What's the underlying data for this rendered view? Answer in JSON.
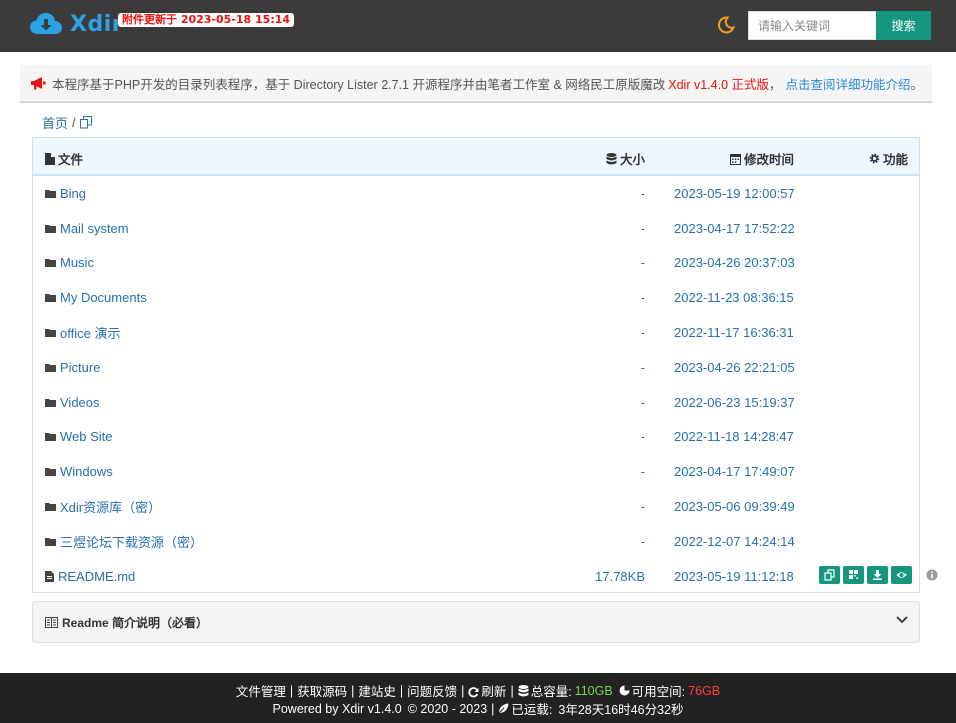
{
  "header": {
    "logo_text": "Xdir",
    "update_badge": "附件更新于 2023-05-18 15:14",
    "search_placeholder": "请输入关键词",
    "search_button": "搜索",
    "brand_color": "#2aa3e6",
    "accent_color": "#16967f"
  },
  "notice": {
    "text": "本程序基于PHP开发的目录列表程序，基于 Directory Lister 2.7.1 开源程序并由笔者工作室 & 网络民工原版魔改",
    "version": "Xdir v1.4.0 正式版",
    "separator": "，",
    "link": "点击查阅详细功能介绍",
    "end": "。"
  },
  "breadcrumb": {
    "home": "首页",
    "separator": "/"
  },
  "table": {
    "headers": {
      "file": "文件",
      "size": "大小",
      "modified": "修改时间",
      "actions": "功能"
    },
    "rows": [
      {
        "name": "Bing",
        "size": "-",
        "time": "2023-05-19 12:00:57",
        "type": "folder"
      },
      {
        "name": "Mail system",
        "size": "-",
        "time": "2023-04-17 17:52:22",
        "type": "folder"
      },
      {
        "name": "Music",
        "size": "-",
        "time": "2023-04-26 20:37:03",
        "type": "folder"
      },
      {
        "name": "My Documents",
        "size": "-",
        "time": "2022-11-23 08:36:15",
        "type": "folder"
      },
      {
        "name": "office 演示",
        "size": "-",
        "time": "2022-11-17 16:36:31",
        "type": "folder"
      },
      {
        "name": "Picture",
        "size": "-",
        "time": "2023-04-26 22:21:05",
        "type": "folder"
      },
      {
        "name": "Videos",
        "size": "-",
        "time": "2022-06-23 15:19:37",
        "type": "folder"
      },
      {
        "name": "Web Site",
        "size": "-",
        "time": "2022-11-18 14:28:47",
        "type": "folder"
      },
      {
        "name": "Windows",
        "size": "-",
        "time": "2023-04-17 17:49:07",
        "type": "folder"
      },
      {
        "name": "Xdir资源库（密）",
        "size": "-",
        "time": "2023-05-06 09:39:49",
        "type": "folder"
      },
      {
        "name": "三煜论坛下载资源（密）",
        "size": "-",
        "time": "2022-12-07 14:24:14",
        "type": "folder"
      },
      {
        "name": "README.md",
        "size": "17.78KB",
        "time": "2023-05-19 11:12:18",
        "type": "file"
      }
    ]
  },
  "readme": {
    "title": "Readme 简介说明（必看）"
  },
  "footer": {
    "links": [
      "文件管理",
      "获取源码",
      "建站史",
      "问题反馈"
    ],
    "refresh": "刷新",
    "total_label": "总容量:",
    "total_value": "110GB",
    "free_label": "可用空间:",
    "free_value": "76GB",
    "powered": "Powered by Xdir v1.4.0",
    "copyright": "© 2020 - 2023",
    "uptime_label": "已运载:",
    "uptime_value": "3年28天16时46分32秒",
    "separator": "|"
  }
}
